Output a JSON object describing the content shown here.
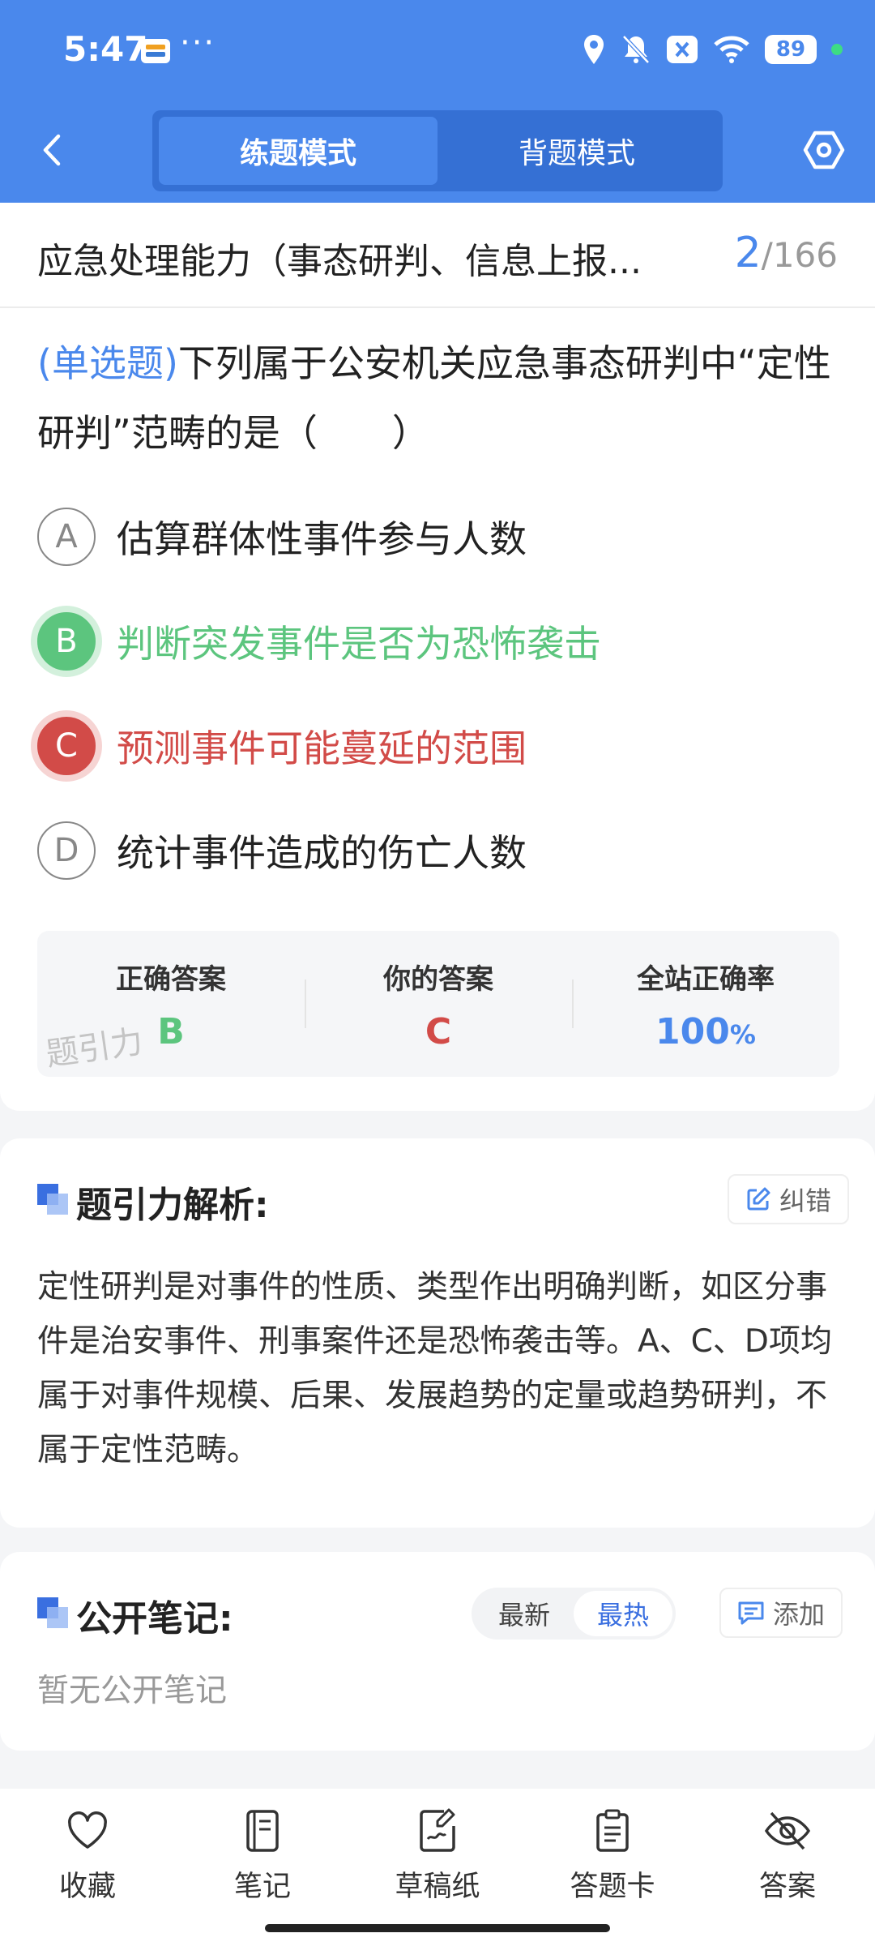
{
  "status_bar": {
    "time": "5:47",
    "more": "···",
    "battery": "89"
  },
  "header": {
    "tabs": [
      {
        "label": "练题模式",
        "active": true
      },
      {
        "label": "背题模式",
        "active": false
      }
    ]
  },
  "question": {
    "title": "应急处理能力（事态研判、信息上报...",
    "current": "2",
    "total": "/166",
    "type_tag": "(单选题)",
    "text": "下列属于公安机关应急事态研判中“定性研判”范畴的是（　　）",
    "options": [
      {
        "letter": "A",
        "text": "估算群体性事件参与人数"
      },
      {
        "letter": "B",
        "text": "判断突发事件是否为恐怖袭击"
      },
      {
        "letter": "C",
        "text": "预测事件可能蔓延的范围"
      },
      {
        "letter": "D",
        "text": "统计事件造成的伤亡人数"
      }
    ]
  },
  "result": {
    "correct_label": "正确答案",
    "correct_value": "B",
    "yours_label": "你的答案",
    "yours_value": "C",
    "rate_label": "全站正确率",
    "rate_value": "100",
    "rate_unit": "%",
    "watermark": "题引力"
  },
  "analysis": {
    "title": "题引力解析:",
    "report_label": "纠错",
    "text": "定性研判是对事件的性质、类型作出明确判断，如区分事件是治安事件、刑事案件还是恐怖袭击等。A、C、D项均属于对事件规模、后果、发展趋势的定量或趋势研判，不属于定性范畴。"
  },
  "notes": {
    "title": "公开笔记:",
    "sort_latest": "最新",
    "sort_hot": "最热",
    "add_label": "添加",
    "empty": "暂无公开笔记"
  },
  "bottom_nav": [
    {
      "label": "收藏",
      "icon": "heart-icon"
    },
    {
      "label": "笔记",
      "icon": "notebook-icon"
    },
    {
      "label": "草稿纸",
      "icon": "draft-paper-icon"
    },
    {
      "label": "答题卡",
      "icon": "answer-sheet-icon"
    },
    {
      "label": "答案",
      "icon": "eye-off-icon"
    }
  ],
  "colors": {
    "brand": "#4a88ec",
    "correct": "#5cc57e",
    "wrong": "#d24b48"
  }
}
